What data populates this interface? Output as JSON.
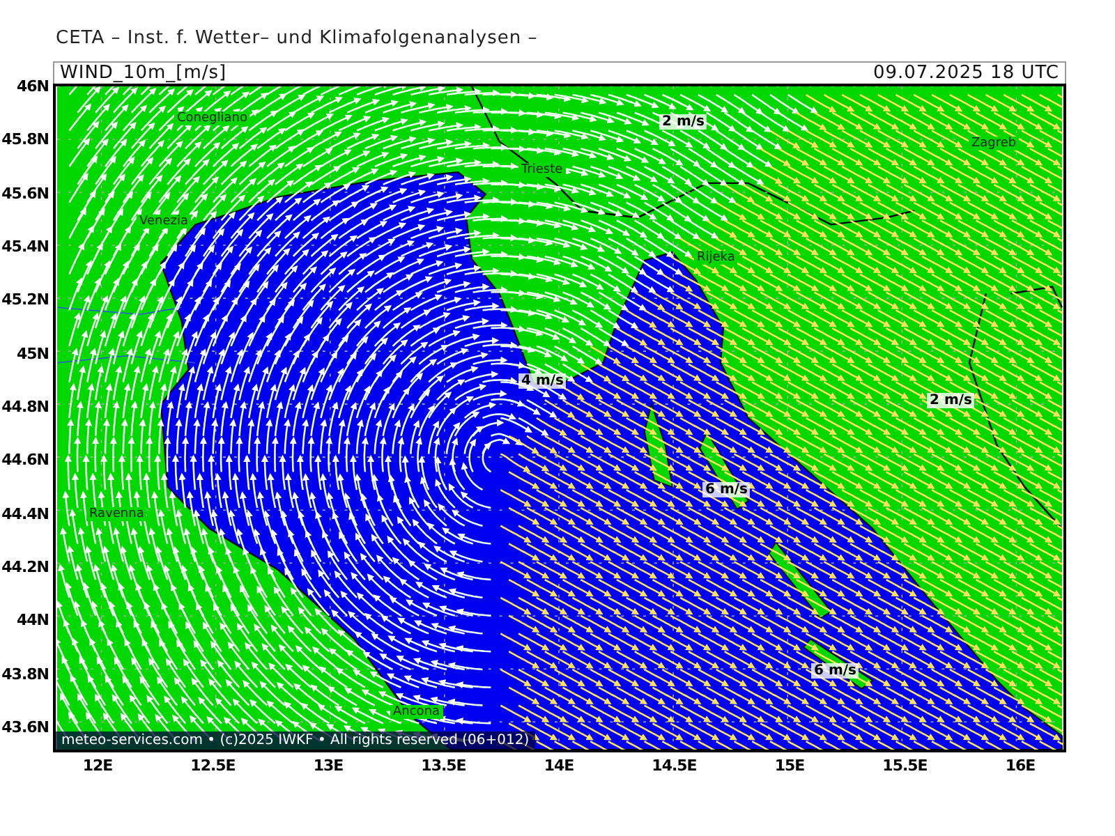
{
  "title": "CETA – Inst. f. Wetter– und Klimafolgenanalysen –",
  "header": {
    "left": "WIND_10m_[m/s]",
    "right": "09.07.2025 18 UTC"
  },
  "map": {
    "y_ticks": [
      "46N",
      "45.8N",
      "45.6N",
      "45.4N",
      "45.2N",
      "45N",
      "44.8N",
      "44.6N",
      "44.4N",
      "44.2N",
      "44N",
      "43.8N",
      "43.6N"
    ],
    "x_ticks": [
      "12E",
      "12.5E",
      "13E",
      "13.5E",
      "14E",
      "14.5E",
      "15E",
      "15.5E",
      "16E"
    ],
    "places": [
      {
        "name": "Conegliano"
      },
      {
        "name": "Venezia"
      },
      {
        "name": "Trieste"
      },
      {
        "name": "Rijeka"
      },
      {
        "name": "Zagreb"
      },
      {
        "name": "Ravenna"
      },
      {
        "name": "Ancona"
      }
    ],
    "speed_labels": [
      {
        "text": "2 m/s"
      },
      {
        "text": "4 m/s"
      },
      {
        "text": "2 m/s"
      },
      {
        "text": "6 m/s"
      },
      {
        "text": "6 m/s"
      }
    ],
    "footer": "meteo-services.com • (c)2025 IWKF • All rights reserved (06+012)"
  }
}
